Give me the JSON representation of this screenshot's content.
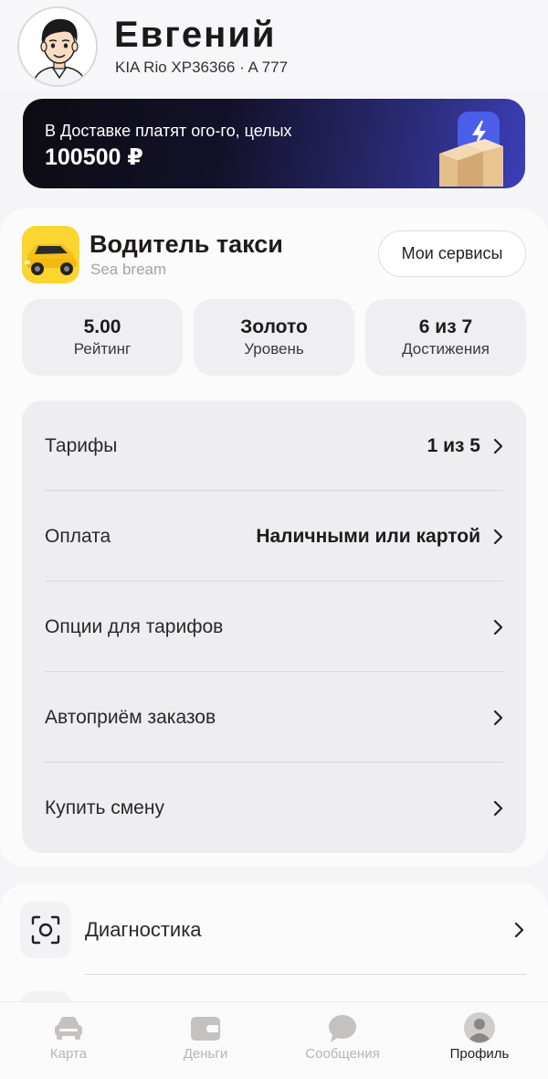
{
  "profile": {
    "name": "Евгений",
    "car": "KIA Rio XP36366 · A 777"
  },
  "promo": {
    "text": "В Доставке платят ого-го, целых",
    "amount": "100500 ₽"
  },
  "service": {
    "title": "Водитель такси",
    "subtitle": "Sea bream",
    "my_services_label": "Мои сервисы"
  },
  "stats": [
    {
      "value": "5.00",
      "label": "Рейтинг"
    },
    {
      "value": "Золото",
      "label": "Уровень"
    },
    {
      "value": "6 из 7",
      "label": "Достижения"
    }
  ],
  "settings": [
    {
      "label": "Тарифы",
      "value": "1 из 5"
    },
    {
      "label": "Оплата",
      "value": "Наличными или картой"
    },
    {
      "label": "Опции для тарифов",
      "value": ""
    },
    {
      "label": "Автоприём заказов",
      "value": ""
    },
    {
      "label": "Купить смену",
      "value": ""
    }
  ],
  "diagnostics": {
    "label": "Диагностика"
  },
  "nav": [
    {
      "label": "Карта",
      "icon": "car-icon",
      "active": false
    },
    {
      "label": "Деньги",
      "icon": "wallet-icon",
      "active": false
    },
    {
      "label": "Сообщения",
      "icon": "chat-icon",
      "active": false
    },
    {
      "label": "Профиль",
      "icon": "profile-icon",
      "active": true
    }
  ],
  "colors": {
    "accent_yellow": "#fcd52f",
    "promo_gradient_end": "#3b3fb8",
    "background": "#f5f4f6"
  }
}
